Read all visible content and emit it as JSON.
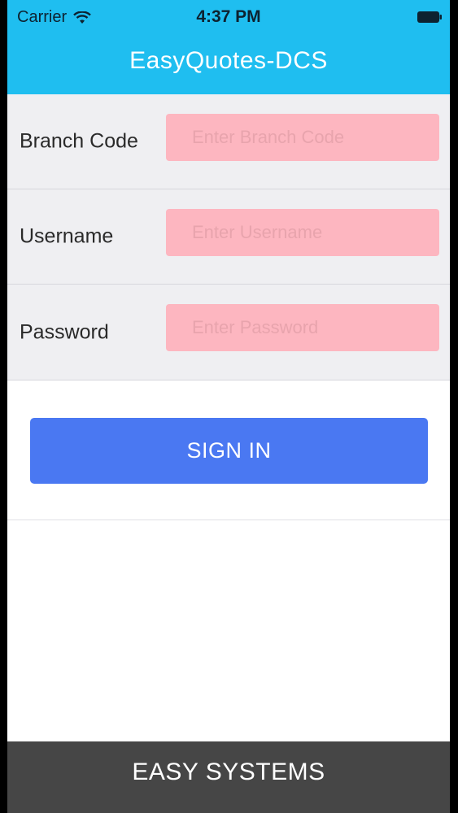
{
  "status_bar": {
    "carrier": "Carrier",
    "time": "4:37 PM"
  },
  "header": {
    "title": "EasyQuotes-DCS",
    "color": "#1fbef0"
  },
  "form": {
    "branch_code": {
      "label": "Branch Code",
      "placeholder": "Enter Branch Code",
      "value": ""
    },
    "username": {
      "label": "Username",
      "placeholder": "Enter Username",
      "value": ""
    },
    "password": {
      "label": "Password",
      "placeholder": "Enter Password",
      "value": ""
    }
  },
  "actions": {
    "sign_in_label": "SIGN IN",
    "sign_in_color": "#4a78f2"
  },
  "footer": {
    "text": "EASY SYSTEMS"
  }
}
